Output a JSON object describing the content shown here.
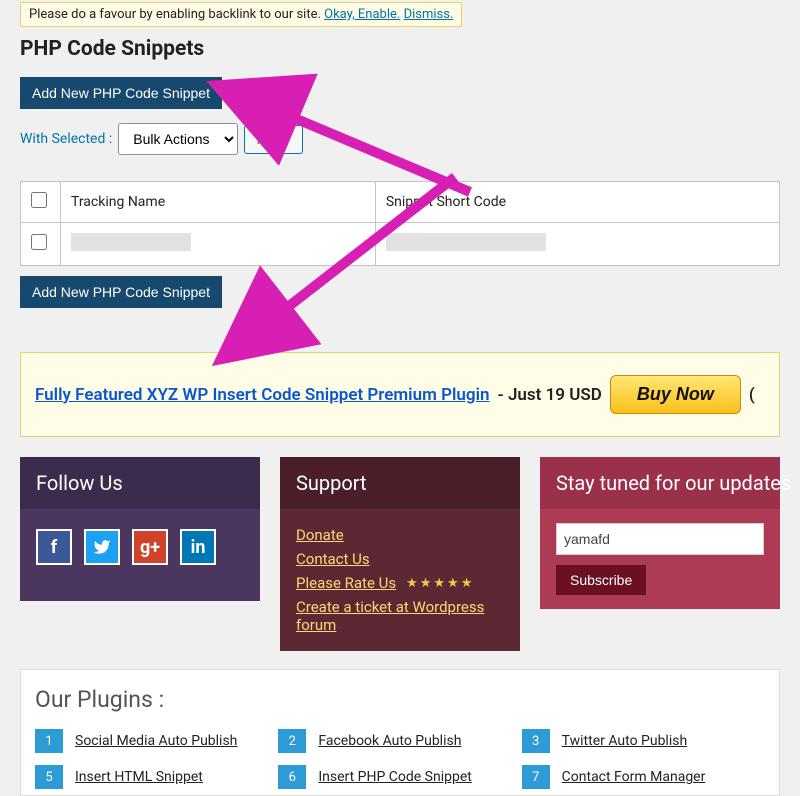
{
  "notice": {
    "text": "Please do a favour by enabling backlink to our site.",
    "enable": "Okay, Enable.",
    "dismiss": "Dismiss."
  },
  "page_title": "PHP Code Snippets",
  "add_button": "Add New PHP Code Snippet",
  "bulk": {
    "label": "With Selected :",
    "default_option": "Bulk Actions",
    "apply": "Apply"
  },
  "table": {
    "col1": "Tracking Name",
    "col2": "Snippet Short Code"
  },
  "promo": {
    "link_text": "Fully Featured XYZ WP Insert Code Snippet Premium Plugin",
    "price_text": " - Just 19 USD",
    "buy": "Buy Now",
    "paren": "("
  },
  "footer_panels": {
    "follow": {
      "title": "Follow Us"
    },
    "support": {
      "title": "Support",
      "donate": "Donate",
      "contact": "Contact Us",
      "rate": "Please Rate Us",
      "stars": "★★★★★",
      "ticket": "Create a ticket at Wordpress forum"
    },
    "subscribe": {
      "title": "Stay tuned for our updates",
      "value": "yamafd",
      "btn": "Subscribe"
    }
  },
  "plugins": {
    "title": "Our Plugins :",
    "list": [
      {
        "n": "1",
        "name": "Social Media Auto Publish"
      },
      {
        "n": "2",
        "name": "Facebook Auto Publish"
      },
      {
        "n": "3",
        "name": "Twitter Auto Publish"
      },
      {
        "n": "5",
        "name": "Insert HTML Snippet"
      },
      {
        "n": "6",
        "name": "Insert PHP Code Snippet"
      },
      {
        "n": "7",
        "name": "Contact Form Manager"
      }
    ]
  }
}
